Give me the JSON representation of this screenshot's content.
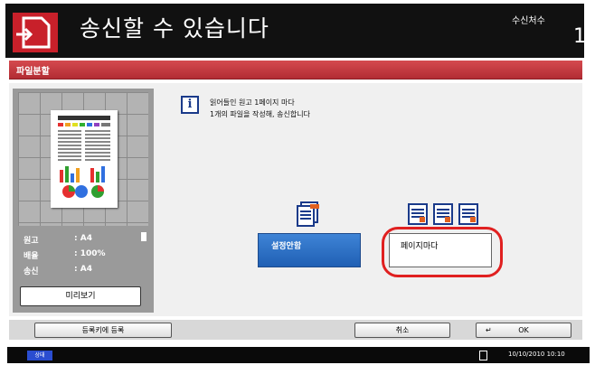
{
  "header": {
    "title": "송신할 수 있습니다",
    "destination_label": "수신처수",
    "destination_count": "1"
  },
  "function_bar": {
    "title": "파일분할"
  },
  "preview": {
    "info": [
      {
        "label": "원고",
        "value": ": A4"
      },
      {
        "label": "배율",
        "value": ": 100%"
      },
      {
        "label": "송신",
        "value": ": A4"
      }
    ],
    "preview_button": "미리보기"
  },
  "message": {
    "line1": "읽어들인 원고 1페이지 마다",
    "line2": "1개의 파일을 작성해, 송신합니다"
  },
  "options": {
    "settings_label": "설정안함",
    "per_page_label": "페이지마다",
    "selected": "per_page"
  },
  "bottom": {
    "register_label": "등록키에 등록",
    "cancel_label": "취소",
    "ok_label": "OK"
  },
  "status": {
    "badge": "상태",
    "datetime": "10/10/2010  10:10"
  },
  "colors": {
    "header_bg": "#111111",
    "logo_red": "#c8202a",
    "function_bar": "#c63a40",
    "selected_blue": "#2e72c8",
    "highlight_red": "#e02020"
  },
  "icons": [
    "send-document-icon",
    "info-icon",
    "single-document-icon",
    "multi-document-icon",
    "enter-key-icon"
  ]
}
